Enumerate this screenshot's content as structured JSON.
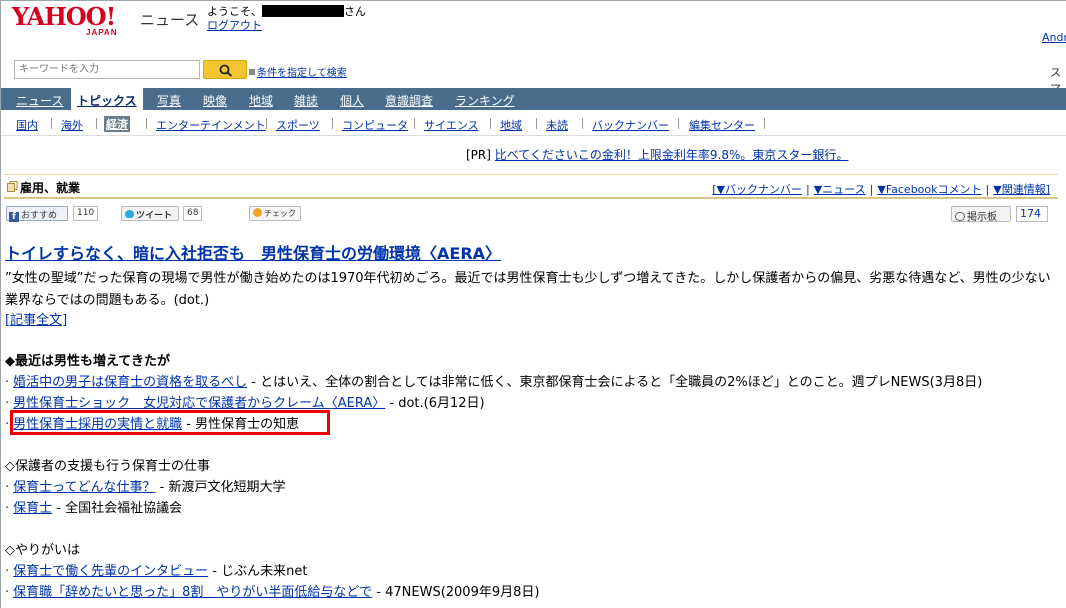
{
  "header": {
    "logo_text": "YAHOO!",
    "logo_sub": "JAPAN",
    "service_name": "ニュース",
    "welcome_prefix": "ようこそ、",
    "welcome_suffix": "さん",
    "logout": "ログアウト",
    "right_link": "Andr"
  },
  "search": {
    "placeholder": "キーワードを入力",
    "advanced": "条件を指定して検索",
    "right_text": "スマ"
  },
  "nav": {
    "items": [
      {
        "label": "ニュース"
      },
      {
        "label": "トピックス",
        "active": true
      },
      {
        "label": "写真"
      },
      {
        "label": "映像"
      },
      {
        "label": "地域"
      },
      {
        "label": "雑誌"
      },
      {
        "label": "個人"
      },
      {
        "label": "意識調査"
      },
      {
        "label": "ランキング"
      }
    ]
  },
  "subnav": {
    "items": [
      {
        "label": "国内"
      },
      {
        "label": "海外"
      },
      {
        "label": "経済",
        "active": true
      },
      {
        "label": "エンターテインメント"
      },
      {
        "label": "スポーツ"
      },
      {
        "label": "コンピュータ"
      },
      {
        "label": "サイエンス"
      },
      {
        "label": "地域"
      },
      {
        "label": "未読"
      },
      {
        "label": "バックナンバー"
      },
      {
        "label": "編集センター"
      }
    ]
  },
  "pr": {
    "tag": "[PR]",
    "text": "比べてくださいこの金利！上限金利年率9.8%。東京スター銀行。"
  },
  "section": {
    "title": "雇用、就業",
    "links": [
      "[▼バックナンバー",
      "▼ニュース",
      "▼Facebookコメント",
      "▼関連情報]"
    ]
  },
  "social": {
    "fb_label": "おすすめ",
    "fb_count": "110",
    "tw_label": "ツイート",
    "tw_count": "68",
    "check_label": "チェック",
    "board_label": "掲示板",
    "board_count": "174"
  },
  "article": {
    "headline": "トイレすらなく、暗に入社拒否も　男性保育士の労働環境〈AERA〉",
    "summary": "”女性の聖域”だった保育の現場で男性が働き始めたのは1970年代初めごろ。最近では男性保育士も少しずつ増えてきた。しかし保護者からの偏見、劣悪な待遇など、男性の少ない業界ならではの問題もある。(dot.)",
    "full_link": "[記事全文]"
  },
  "groups": [
    {
      "title": "◆最近は男性も増えてきたが",
      "bold": true,
      "items": [
        {
          "link": "婚活中の男子は保育士の資格を取るべし",
          "suffix": " - とはいえ、全体の割合としては非常に低く、東京都保育士会によると「全職員の2%ほど」とのこと。週プレNEWS(3月8日)"
        },
        {
          "link": "男性保育士ショック　女児対応で保護者からクレーム〈AERA〉",
          "suffix": " - dot.(6月12日)"
        },
        {
          "link": "男性保育士採用の実情と就職",
          "suffix": " - 男性保育士の知恵"
        }
      ]
    },
    {
      "title": "◇保護者の支援も行う保育士の仕事",
      "bold": false,
      "items": [
        {
          "link": "保育士ってどんな仕事？",
          "suffix": " - 新渡戸文化短期大学"
        },
        {
          "link": "保育士",
          "suffix": " - 全国社会福祉協議会"
        }
      ]
    },
    {
      "title": "◇やりがいは",
      "bold": false,
      "items": [
        {
          "link": "保育士で働く先輩のインタビュー",
          "suffix": " - じぶん未来net"
        },
        {
          "link": "保育職「辞めたいと思った」8割　やりがい半面低給与などで",
          "suffix": " - 47NEWS(2009年9月8日)"
        }
      ]
    }
  ],
  "colors": {
    "nav_bg": "#4a6d8d",
    "link": "#0033aa",
    "logo_red": "#d70021",
    "highlight": "#ee0000"
  }
}
